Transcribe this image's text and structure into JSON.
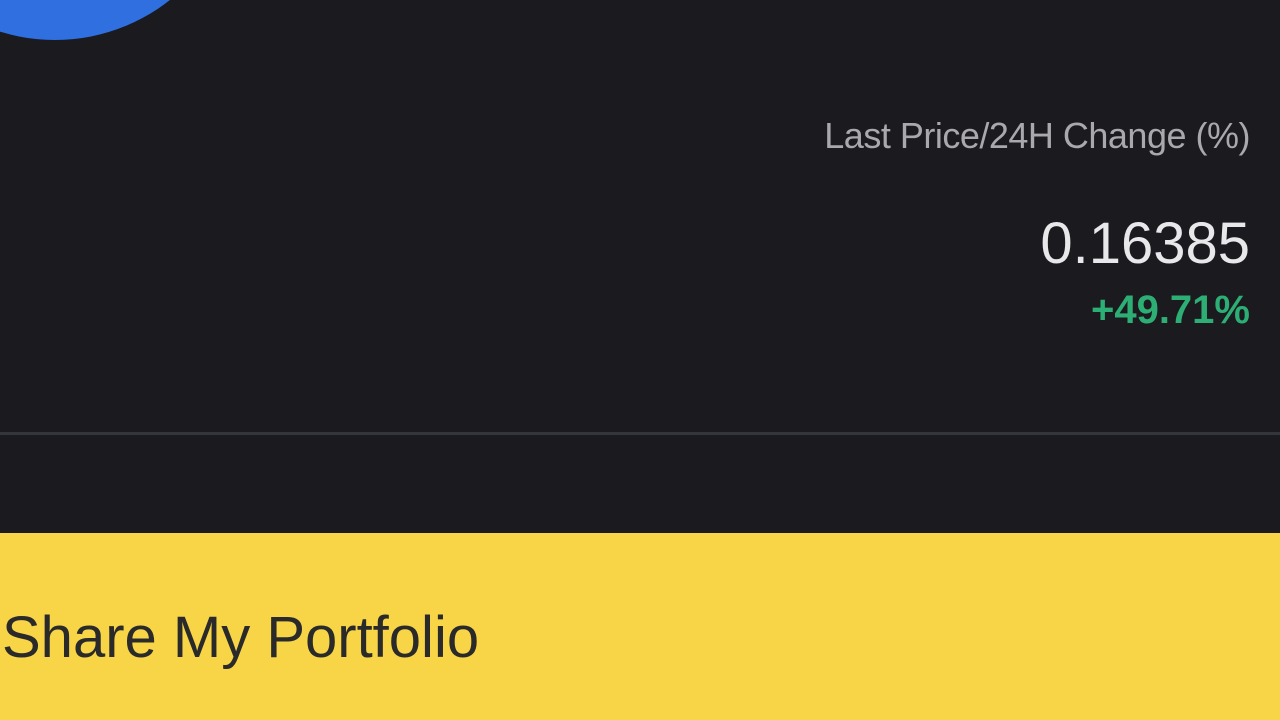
{
  "ticker": {
    "label": "Last Price/24H Change (%)",
    "last_price": "0.16385",
    "change_24h": "+49.71%",
    "coin_logo": "coin-logo-icon"
  },
  "actions": {
    "share_portfolio_label": "Share My Portfolio"
  },
  "colors": {
    "background": "#1a1a1f",
    "accent": "#f7d547",
    "positive": "#2dae74",
    "logo": "#2f6fe0"
  }
}
